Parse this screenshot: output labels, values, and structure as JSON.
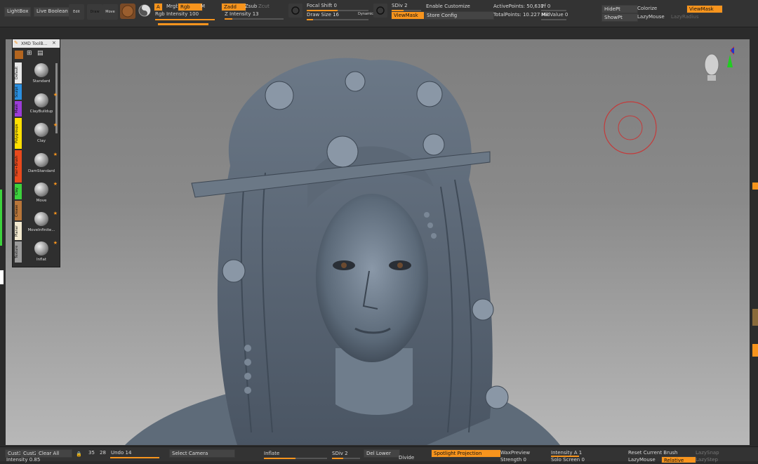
{
  "topbar": {
    "lightbox": "LightBox",
    "live_boolean": "Live Boolean",
    "dynamic_small": "Dynamic",
    "edit": "Edit",
    "draw": "Draw",
    "move": "Move",
    "a_button": "A",
    "mrgb": "Mrgb",
    "rgb": "Rgb",
    "m": "M",
    "rgb_intensity": "Rgb Intensity 100",
    "zadd": "Zadd",
    "zsub": "Zsub",
    "zcut": "Zcut",
    "z_intensity": "Z Intensity 13",
    "focal_shift": "Focal Shift 0",
    "draw_size": "Draw Size 16",
    "dynamic": "Dynamic",
    "enable_customize": "Enable Customize",
    "store_config": "Store Config",
    "sdiv": "SDiv 2",
    "viewmask": "ViewMask",
    "active_points": "ActivePoints: 50,631",
    "total_points": "TotalPoints: 10.227 Mil",
    "pf": "Pf 0",
    "mid_value": "MidValue 0",
    "hidept": "HidePt",
    "showpt": "ShowPt",
    "colorize": "Colorize",
    "lazymouse": "LazyMouse",
    "viewmask2": "ViewMask",
    "lazyradius": "LazyRadius"
  },
  "palette": {
    "title": "XMD ToolB...",
    "close": "×",
    "tabs": [
      "Default",
      "Sculpt",
      "Mask",
      "Polygroups",
      "Hair+Brush",
      "Clay",
      "Crease",
      "Planar",
      "Texture"
    ],
    "brushes": [
      "Standard",
      "ClayBuildup",
      "Clay",
      "DamStandard",
      "Move",
      "MoveInfinite...",
      "Inflat"
    ]
  },
  "bottombar": {
    "cust1": "Cust1",
    "cust2": "Cust2",
    "clear_all": "Clear All",
    "intensity": "Intensity 0.85",
    "n35": "35",
    "n28": "28",
    "undo": "Undo 14",
    "select_camera": "Select Camera",
    "inflate": "Inflate",
    "sdiv2": "SDiv 2",
    "del_lower": "Del Lower",
    "divide": "Divide",
    "spotlight": "Spotlight Projection",
    "waxpreview": "WaxPreview",
    "strength": "Strength 0",
    "intensity_a": "Intensity A 1",
    "solo_screen": "Solo Screen 0",
    "reset_brush": "Reset Current Brush",
    "lazysnap": "LazySnap",
    "lazymouse": "LazyMouse",
    "relative": "Relative",
    "lazystep": "LazyStep"
  },
  "colors": {
    "accent": "#f7941d",
    "cursor_ring": "#c43a3a"
  }
}
